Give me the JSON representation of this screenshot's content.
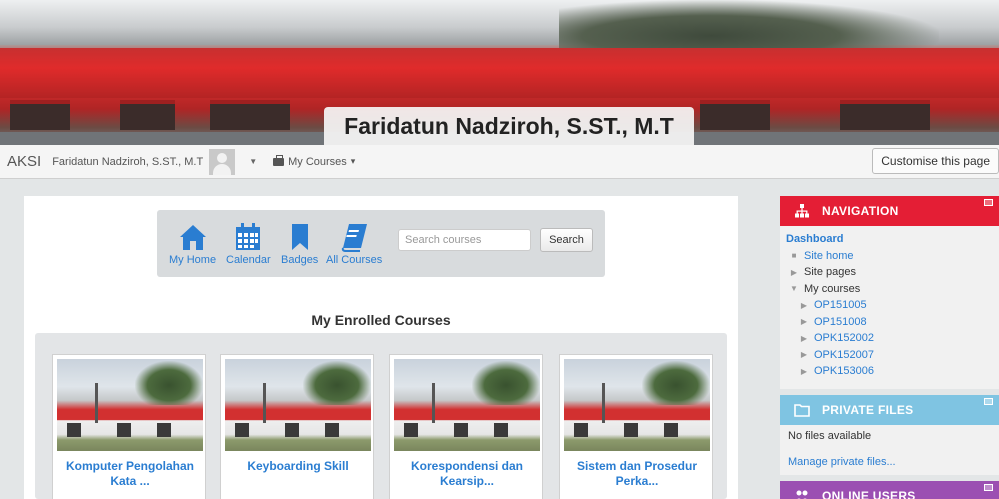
{
  "header": {
    "site_owner_name": "Faridatun Nadziroh, S.ST., M.T"
  },
  "navbar": {
    "brand": "AKSI",
    "user_name": "Faridatun Nadziroh, S.ST., M.T",
    "user_menu_caret": "▼",
    "courses_menu_label": "My Courses",
    "courses_menu_caret": "▾",
    "customise_label": "Customise this page"
  },
  "quick_links": {
    "items": [
      {
        "label": "My Home",
        "icon": "home-icon"
      },
      {
        "label": "Calendar",
        "icon": "calendar-icon"
      },
      {
        "label": "Badges",
        "icon": "bookmark-icon"
      },
      {
        "label": "All Courses",
        "icon": "book-icon"
      }
    ],
    "search_placeholder": "Search courses",
    "search_button": "Search"
  },
  "enrolled": {
    "title": "My Enrolled Courses",
    "courses": [
      {
        "name": "Komputer Pengolahan Kata ..."
      },
      {
        "name": "Keyboarding Skill"
      },
      {
        "name": "Korespondensi dan Kearsip..."
      },
      {
        "name": "Sistem dan Prosedur Perka..."
      }
    ]
  },
  "navigation_block": {
    "title": "NAVIGATION",
    "items": [
      {
        "label": "Dashboard"
      },
      {
        "label": "Site home"
      },
      {
        "label": "Site pages"
      },
      {
        "label": "My courses"
      },
      {
        "label": "OP151005"
      },
      {
        "label": "OP151008"
      },
      {
        "label": "OPK152002"
      },
      {
        "label": "OPK152007"
      },
      {
        "label": "OPK153006"
      }
    ]
  },
  "private_files_block": {
    "title": "PRIVATE FILES",
    "empty_text": "No files available",
    "manage_link": "Manage private files..."
  },
  "online_users_block": {
    "title": "ONLINE USERS"
  },
  "colors": {
    "navigation_header": "#e41e35",
    "private_files_header": "#7fc4e2",
    "online_users_header": "#9b4fb2",
    "link": "#2a7dd1"
  }
}
